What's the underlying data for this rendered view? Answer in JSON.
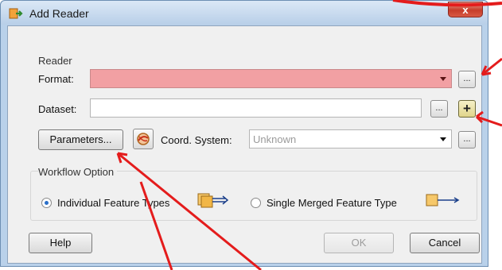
{
  "window": {
    "title": "Add Reader",
    "close_glyph": "x"
  },
  "reader_group": {
    "caption": "Reader",
    "format": {
      "label": "Format:",
      "value": ""
    },
    "dataset": {
      "label": "Dataset:",
      "value": ""
    },
    "browse_glyph": "...",
    "add_glyph": "+",
    "parameters_label": "Parameters...",
    "coord": {
      "label": "Coord. System:",
      "value": "Unknown"
    }
  },
  "workflow_group": {
    "caption": "Workflow Option",
    "individual": {
      "label": "Individual Feature Types",
      "selected": true
    },
    "merged": {
      "label": "Single Merged Feature Type",
      "selected": false
    }
  },
  "buttons": {
    "help": "Help",
    "ok": "OK",
    "cancel": "Cancel"
  },
  "annotation": {
    "arrow_color": "#e41c1c",
    "error_color": "#f2a0a3"
  },
  "icons": [
    "reader-app-icon",
    "coord-system-icon",
    "individual-feature-types-icon",
    "merged-feature-type-icon"
  ]
}
